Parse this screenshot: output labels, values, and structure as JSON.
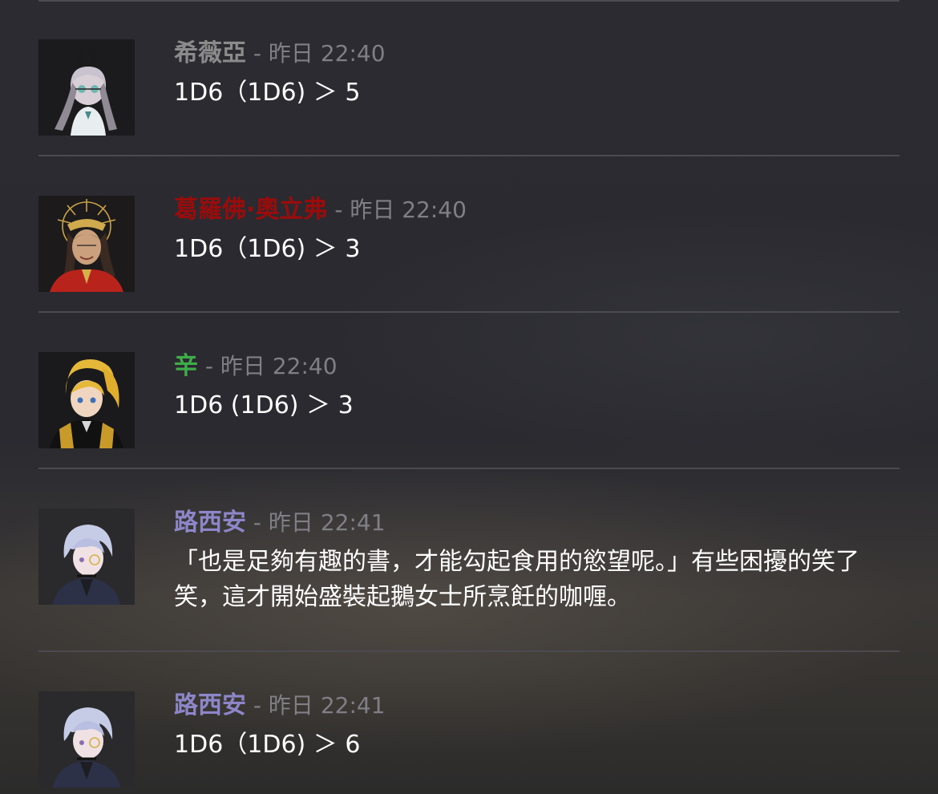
{
  "messages": [
    {
      "author": "希薇亞",
      "author_color": "#8b8b8b",
      "separator": "-",
      "time": "昨日 22:40",
      "text": "1D6（1D6) ＞ 5",
      "avatar": "white-haired-bunny-ear-girl-avatar"
    },
    {
      "author": "葛羅佛·奧立弗",
      "author_color": "#9a0c0c",
      "separator": "-",
      "time": "昨日 22:40",
      "text": "1D6（1D6) ＞ 3",
      "avatar": "crowned-dark-haired-man-avatar"
    },
    {
      "author": "辛",
      "author_color": "#3fae49",
      "separator": "-",
      "time": "昨日 22:40",
      "text": "1D6 (1D6) ＞ 3",
      "avatar": "blonde-ponytail-warrior-avatar"
    },
    {
      "author": "路西安",
      "author_color": "#8d86c9",
      "separator": "-",
      "time": "昨日 22:41",
      "text": "「也是足夠有趣的書，才能勾起食用的慾望呢。」有些困擾的笑了笑，這才開始盛裝起鵝女士所烹飪的咖喱。",
      "avatar": "silver-haired-monocle-man-avatar"
    },
    {
      "author": "路西安",
      "author_color": "#8d86c9",
      "separator": "-",
      "time": "昨日 22:41",
      "text": "1D6（1D6) ＞ 6",
      "avatar": "silver-haired-monocle-man-avatar"
    }
  ]
}
